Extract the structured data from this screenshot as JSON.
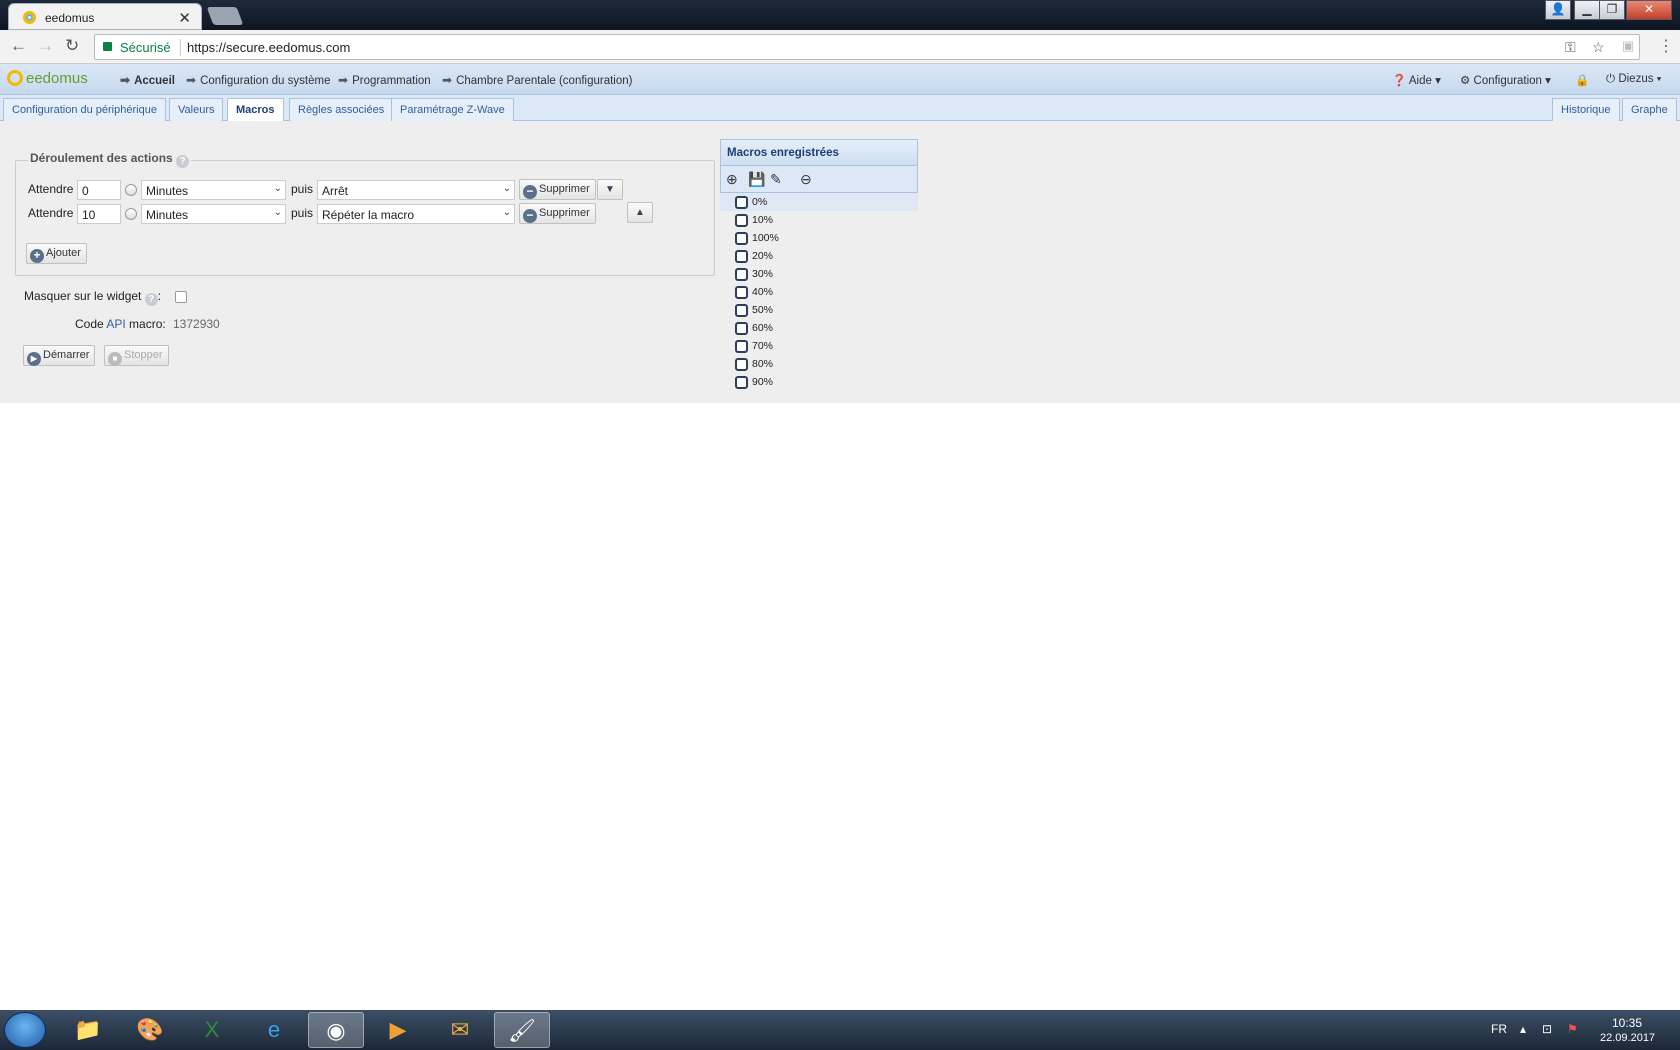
{
  "browser": {
    "tab_title": "eedomus",
    "tab_close": "✕",
    "secure_label": "Sécurisé",
    "url": "https://secure.eedomus.com",
    "window_controls": [
      "▁",
      "❐",
      "✕"
    ]
  },
  "topnav": {
    "logo": "eedomus",
    "breadcrumbs": [
      "Accueil",
      "Configuration du système",
      "Programmation",
      "Chambre Parentale (configuration)"
    ],
    "help": "Aide",
    "config": "Configuration",
    "user": "Diezus"
  },
  "tabs": {
    "left": [
      "Configuration du périphérique",
      "Valeurs",
      "Macros",
      "Règles associées",
      "Paramétrage Z-Wave"
    ],
    "right": [
      "Historique",
      "Graphe"
    ],
    "active": "Macros"
  },
  "actions": {
    "legend": "Déroulement des actions",
    "wait_label": "Attendre",
    "then_label": "puis",
    "delete_label": "Supprimer",
    "add_label": "Ajouter",
    "rows": [
      {
        "delay": "0",
        "unit": "Minutes",
        "action": "Arrêt"
      },
      {
        "delay": "10",
        "unit": "Minutes",
        "action": "Répéter la macro"
      }
    ]
  },
  "widget": {
    "hide_label": "Masquer sur le widget",
    "code_label": "Code",
    "api_label": "API",
    "macro_label": "macro:",
    "code_value": "1372930"
  },
  "buttons": {
    "start": "Démarrer",
    "stop": "Stopper"
  },
  "saved_macros": {
    "title": "Macros enregistrées",
    "items": [
      "0%",
      "10%",
      "100%",
      "20%",
      "30%",
      "40%",
      "50%",
      "60%",
      "70%",
      "80%",
      "90%"
    ],
    "selected": "0%"
  },
  "taskbar": {
    "lang": "FR",
    "time": "10:35",
    "date": "22.09.2017"
  },
  "colors": {
    "accent": "#1e3f72",
    "nav_bg": "#dce8f5",
    "secure": "#0b8043"
  }
}
